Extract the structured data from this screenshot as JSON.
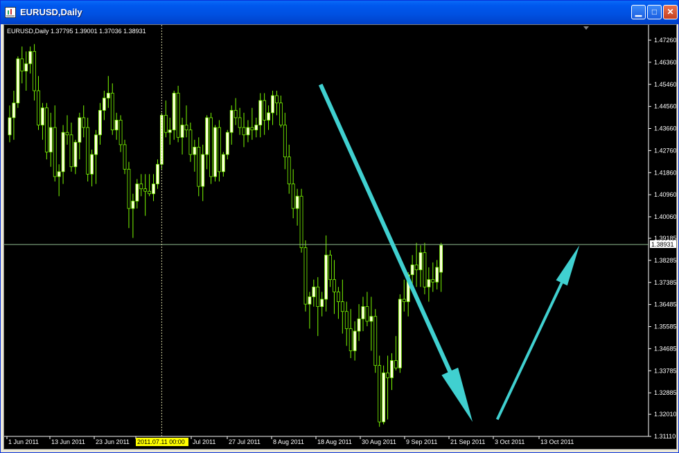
{
  "window": {
    "title": "EURUSD,Daily",
    "title_color": "#ffffff"
  },
  "chart_data": {
    "type": "candlestick",
    "info_line": "EURUSD,Daily  1.37795 1.39001 1.37036 1.38931",
    "symbol": "EURUSD,Daily",
    "ohlc_last": {
      "open": 1.37795,
      "high": 1.39001,
      "low": 1.37036,
      "close": 1.38931
    },
    "y_ticks": [
      "1.47260",
      "1.46360",
      "1.45460",
      "1.44560",
      "1.43660",
      "1.42760",
      "1.41860",
      "1.40960",
      "1.40060",
      "1.39185",
      "1.38285",
      "1.37385",
      "1.36485",
      "1.35585",
      "1.34685",
      "1.33785",
      "1.32885",
      "1.32010",
      "1.31110"
    ],
    "y_range": [
      1.3111,
      1.4726
    ],
    "current_price_label": "1.38931",
    "current_price": 1.38931,
    "x_labels": [
      "1 Jun 2011",
      "13 Jun 2011",
      "23 Jun 2011",
      "2011.07.11 00:00",
      "Jul 2011",
      "27 Jul 2011",
      "8 Aug 2011",
      "18 Aug 2011",
      "30 Aug 2011",
      "9 Sep 2011",
      "21 Sep 2011",
      "3 Oct 2011",
      "13 Oct 2011"
    ],
    "crosshair_label": "2011.07.11 00:00",
    "bull_color": "#ffffe0",
    "bear_color": "#000000",
    "wick_color": "#7cfc00",
    "arrow_color": "#40d0d0",
    "grid": false,
    "candles": [
      {
        "o": 1.434,
        "h": 1.446,
        "l": 1.431,
        "c": 1.441
      },
      {
        "o": 1.441,
        "h": 1.452,
        "l": 1.432,
        "c": 1.447
      },
      {
        "o": 1.447,
        "h": 1.466,
        "l": 1.445,
        "c": 1.465
      },
      {
        "o": 1.465,
        "h": 1.47,
        "l": 1.455,
        "c": 1.46
      },
      {
        "o": 1.46,
        "h": 1.468,
        "l": 1.452,
        "c": 1.463
      },
      {
        "o": 1.463,
        "h": 1.47,
        "l": 1.459,
        "c": 1.468
      },
      {
        "o": 1.468,
        "h": 1.471,
        "l": 1.448,
        "c": 1.452
      },
      {
        "o": 1.452,
        "h": 1.458,
        "l": 1.436,
        "c": 1.438
      },
      {
        "o": 1.438,
        "h": 1.447,
        "l": 1.432,
        "c": 1.445
      },
      {
        "o": 1.445,
        "h": 1.447,
        "l": 1.424,
        "c": 1.427
      },
      {
        "o": 1.427,
        "h": 1.443,
        "l": 1.421,
        "c": 1.437
      },
      {
        "o": 1.437,
        "h": 1.446,
        "l": 1.415,
        "c": 1.417
      },
      {
        "o": 1.417,
        "h": 1.422,
        "l": 1.409,
        "c": 1.419
      },
      {
        "o": 1.419,
        "h": 1.438,
        "l": 1.414,
        "c": 1.435
      },
      {
        "o": 1.435,
        "h": 1.442,
        "l": 1.43,
        "c": 1.434
      },
      {
        "o": 1.434,
        "h": 1.439,
        "l": 1.419,
        "c": 1.421
      },
      {
        "o": 1.421,
        "h": 1.432,
        "l": 1.418,
        "c": 1.431
      },
      {
        "o": 1.431,
        "h": 1.443,
        "l": 1.424,
        "c": 1.441
      },
      {
        "o": 1.441,
        "h": 1.446,
        "l": 1.433,
        "c": 1.437
      },
      {
        "o": 1.437,
        "h": 1.441,
        "l": 1.415,
        "c": 1.418
      },
      {
        "o": 1.418,
        "h": 1.428,
        "l": 1.413,
        "c": 1.426
      },
      {
        "o": 1.426,
        "h": 1.436,
        "l": 1.414,
        "c": 1.434
      },
      {
        "o": 1.434,
        "h": 1.447,
        "l": 1.43,
        "c": 1.444
      },
      {
        "o": 1.444,
        "h": 1.452,
        "l": 1.44,
        "c": 1.449
      },
      {
        "o": 1.449,
        "h": 1.458,
        "l": 1.445,
        "c": 1.451
      },
      {
        "o": 1.451,
        "h": 1.455,
        "l": 1.434,
        "c": 1.436
      },
      {
        "o": 1.436,
        "h": 1.443,
        "l": 1.432,
        "c": 1.44
      },
      {
        "o": 1.44,
        "h": 1.442,
        "l": 1.427,
        "c": 1.43
      },
      {
        "o": 1.43,
        "h": 1.432,
        "l": 1.418,
        "c": 1.42
      },
      {
        "o": 1.42,
        "h": 1.423,
        "l": 1.396,
        "c": 1.404
      },
      {
        "o": 1.404,
        "h": 1.41,
        "l": 1.392,
        "c": 1.407
      },
      {
        "o": 1.407,
        "h": 1.416,
        "l": 1.404,
        "c": 1.414
      },
      {
        "o": 1.414,
        "h": 1.418,
        "l": 1.409,
        "c": 1.412
      },
      {
        "o": 1.412,
        "h": 1.418,
        "l": 1.401,
        "c": 1.411
      },
      {
        "o": 1.411,
        "h": 1.418,
        "l": 1.409,
        "c": 1.41
      },
      {
        "o": 1.41,
        "h": 1.418,
        "l": 1.407,
        "c": 1.414
      },
      {
        "o": 1.414,
        "h": 1.424,
        "l": 1.412,
        "c": 1.422
      },
      {
        "o": 1.422,
        "h": 1.443,
        "l": 1.42,
        "c": 1.442
      },
      {
        "o": 1.442,
        "h": 1.448,
        "l": 1.433,
        "c": 1.435
      },
      {
        "o": 1.435,
        "h": 1.441,
        "l": 1.43,
        "c": 1.436
      },
      {
        "o": 1.436,
        "h": 1.452,
        "l": 1.432,
        "c": 1.451
      },
      {
        "o": 1.451,
        "h": 1.454,
        "l": 1.431,
        "c": 1.433
      },
      {
        "o": 1.433,
        "h": 1.441,
        "l": 1.426,
        "c": 1.438
      },
      {
        "o": 1.438,
        "h": 1.446,
        "l": 1.433,
        "c": 1.436
      },
      {
        "o": 1.436,
        "h": 1.439,
        "l": 1.423,
        "c": 1.426
      },
      {
        "o": 1.426,
        "h": 1.432,
        "l": 1.419,
        "c": 1.429
      },
      {
        "o": 1.429,
        "h": 1.433,
        "l": 1.409,
        "c": 1.413
      },
      {
        "o": 1.413,
        "h": 1.43,
        "l": 1.407,
        "c": 1.426
      },
      {
        "o": 1.426,
        "h": 1.442,
        "l": 1.42,
        "c": 1.441
      },
      {
        "o": 1.441,
        "h": 1.443,
        "l": 1.414,
        "c": 1.417
      },
      {
        "o": 1.417,
        "h": 1.438,
        "l": 1.415,
        "c": 1.437
      },
      {
        "o": 1.437,
        "h": 1.44,
        "l": 1.415,
        "c": 1.419
      },
      {
        "o": 1.419,
        "h": 1.427,
        "l": 1.417,
        "c": 1.426
      },
      {
        "o": 1.426,
        "h": 1.436,
        "l": 1.424,
        "c": 1.435
      },
      {
        "o": 1.435,
        "h": 1.446,
        "l": 1.43,
        "c": 1.444
      },
      {
        "o": 1.444,
        "h": 1.449,
        "l": 1.438,
        "c": 1.441
      },
      {
        "o": 1.441,
        "h": 1.445,
        "l": 1.434,
        "c": 1.437
      },
      {
        "o": 1.437,
        "h": 1.443,
        "l": 1.429,
        "c": 1.434
      },
      {
        "o": 1.434,
        "h": 1.44,
        "l": 1.431,
        "c": 1.437
      },
      {
        "o": 1.437,
        "h": 1.445,
        "l": 1.432,
        "c": 1.436
      },
      {
        "o": 1.436,
        "h": 1.441,
        "l": 1.433,
        "c": 1.438
      },
      {
        "o": 1.438,
        "h": 1.451,
        "l": 1.433,
        "c": 1.448
      },
      {
        "o": 1.448,
        "h": 1.451,
        "l": 1.434,
        "c": 1.44
      },
      {
        "o": 1.44,
        "h": 1.446,
        "l": 1.436,
        "c": 1.443
      },
      {
        "o": 1.443,
        "h": 1.452,
        "l": 1.438,
        "c": 1.45
      },
      {
        "o": 1.45,
        "h": 1.452,
        "l": 1.442,
        "c": 1.447
      },
      {
        "o": 1.447,
        "h": 1.45,
        "l": 1.437,
        "c": 1.438
      },
      {
        "o": 1.438,
        "h": 1.443,
        "l": 1.42,
        "c": 1.425
      },
      {
        "o": 1.425,
        "h": 1.43,
        "l": 1.41,
        "c": 1.414
      },
      {
        "o": 1.414,
        "h": 1.42,
        "l": 1.4,
        "c": 1.404
      },
      {
        "o": 1.404,
        "h": 1.412,
        "l": 1.397,
        "c": 1.409
      },
      {
        "o": 1.409,
        "h": 1.412,
        "l": 1.386,
        "c": 1.388
      },
      {
        "o": 1.388,
        "h": 1.391,
        "l": 1.362,
        "c": 1.365
      },
      {
        "o": 1.365,
        "h": 1.37,
        "l": 1.355,
        "c": 1.368
      },
      {
        "o": 1.368,
        "h": 1.375,
        "l": 1.364,
        "c": 1.372
      },
      {
        "o": 1.372,
        "h": 1.376,
        "l": 1.352,
        "c": 1.364
      },
      {
        "o": 1.364,
        "h": 1.37,
        "l": 1.36,
        "c": 1.367
      },
      {
        "o": 1.367,
        "h": 1.393,
        "l": 1.362,
        "c": 1.385
      },
      {
        "o": 1.385,
        "h": 1.387,
        "l": 1.372,
        "c": 1.375
      },
      {
        "o": 1.375,
        "h": 1.383,
        "l": 1.361,
        "c": 1.37
      },
      {
        "o": 1.37,
        "h": 1.372,
        "l": 1.359,
        "c": 1.366
      },
      {
        "o": 1.366,
        "h": 1.375,
        "l": 1.353,
        "c": 1.362
      },
      {
        "o": 1.362,
        "h": 1.366,
        "l": 1.348,
        "c": 1.355
      },
      {
        "o": 1.355,
        "h": 1.363,
        "l": 1.343,
        "c": 1.346
      },
      {
        "o": 1.346,
        "h": 1.358,
        "l": 1.342,
        "c": 1.354
      },
      {
        "o": 1.354,
        "h": 1.365,
        "l": 1.35,
        "c": 1.359
      },
      {
        "o": 1.359,
        "h": 1.368,
        "l": 1.354,
        "c": 1.364
      },
      {
        "o": 1.364,
        "h": 1.37,
        "l": 1.356,
        "c": 1.358
      },
      {
        "o": 1.358,
        "h": 1.368,
        "l": 1.346,
        "c": 1.36
      },
      {
        "o": 1.36,
        "h": 1.363,
        "l": 1.337,
        "c": 1.34
      },
      {
        "o": 1.34,
        "h": 1.344,
        "l": 1.315,
        "c": 1.317
      },
      {
        "o": 1.317,
        "h": 1.34,
        "l": 1.316,
        "c": 1.337
      },
      {
        "o": 1.337,
        "h": 1.344,
        "l": 1.318,
        "c": 1.335
      },
      {
        "o": 1.335,
        "h": 1.345,
        "l": 1.33,
        "c": 1.342
      },
      {
        "o": 1.342,
        "h": 1.352,
        "l": 1.338,
        "c": 1.339
      },
      {
        "o": 1.339,
        "h": 1.369,
        "l": 1.337,
        "c": 1.367
      },
      {
        "o": 1.367,
        "h": 1.375,
        "l": 1.362,
        "c": 1.366
      },
      {
        "o": 1.366,
        "h": 1.378,
        "l": 1.36,
        "c": 1.377
      },
      {
        "o": 1.377,
        "h": 1.385,
        "l": 1.37,
        "c": 1.381
      },
      {
        "o": 1.381,
        "h": 1.39,
        "l": 1.372,
        "c": 1.379
      },
      {
        "o": 1.379,
        "h": 1.389,
        "l": 1.372,
        "c": 1.386
      },
      {
        "o": 1.386,
        "h": 1.39,
        "l": 1.369,
        "c": 1.372
      },
      {
        "o": 1.372,
        "h": 1.38,
        "l": 1.366,
        "c": 1.375
      },
      {
        "o": 1.375,
        "h": 1.382,
        "l": 1.37,
        "c": 1.374
      },
      {
        "o": 1.374,
        "h": 1.383,
        "l": 1.371,
        "c": 1.38
      },
      {
        "o": 1.378,
        "h": 1.39,
        "l": 1.37,
        "c": 1.389
      }
    ],
    "annotations": [
      {
        "type": "arrow",
        "from": {
          "bar": 76,
          "price": 1.4545
        },
        "to": {
          "bar": 113,
          "price": 1.317
        },
        "width": "thick"
      },
      {
        "type": "arrow",
        "from": {
          "bar": 119,
          "price": 1.318
        },
        "to": {
          "bar": 139,
          "price": 1.389
        },
        "width": "medium"
      }
    ]
  }
}
